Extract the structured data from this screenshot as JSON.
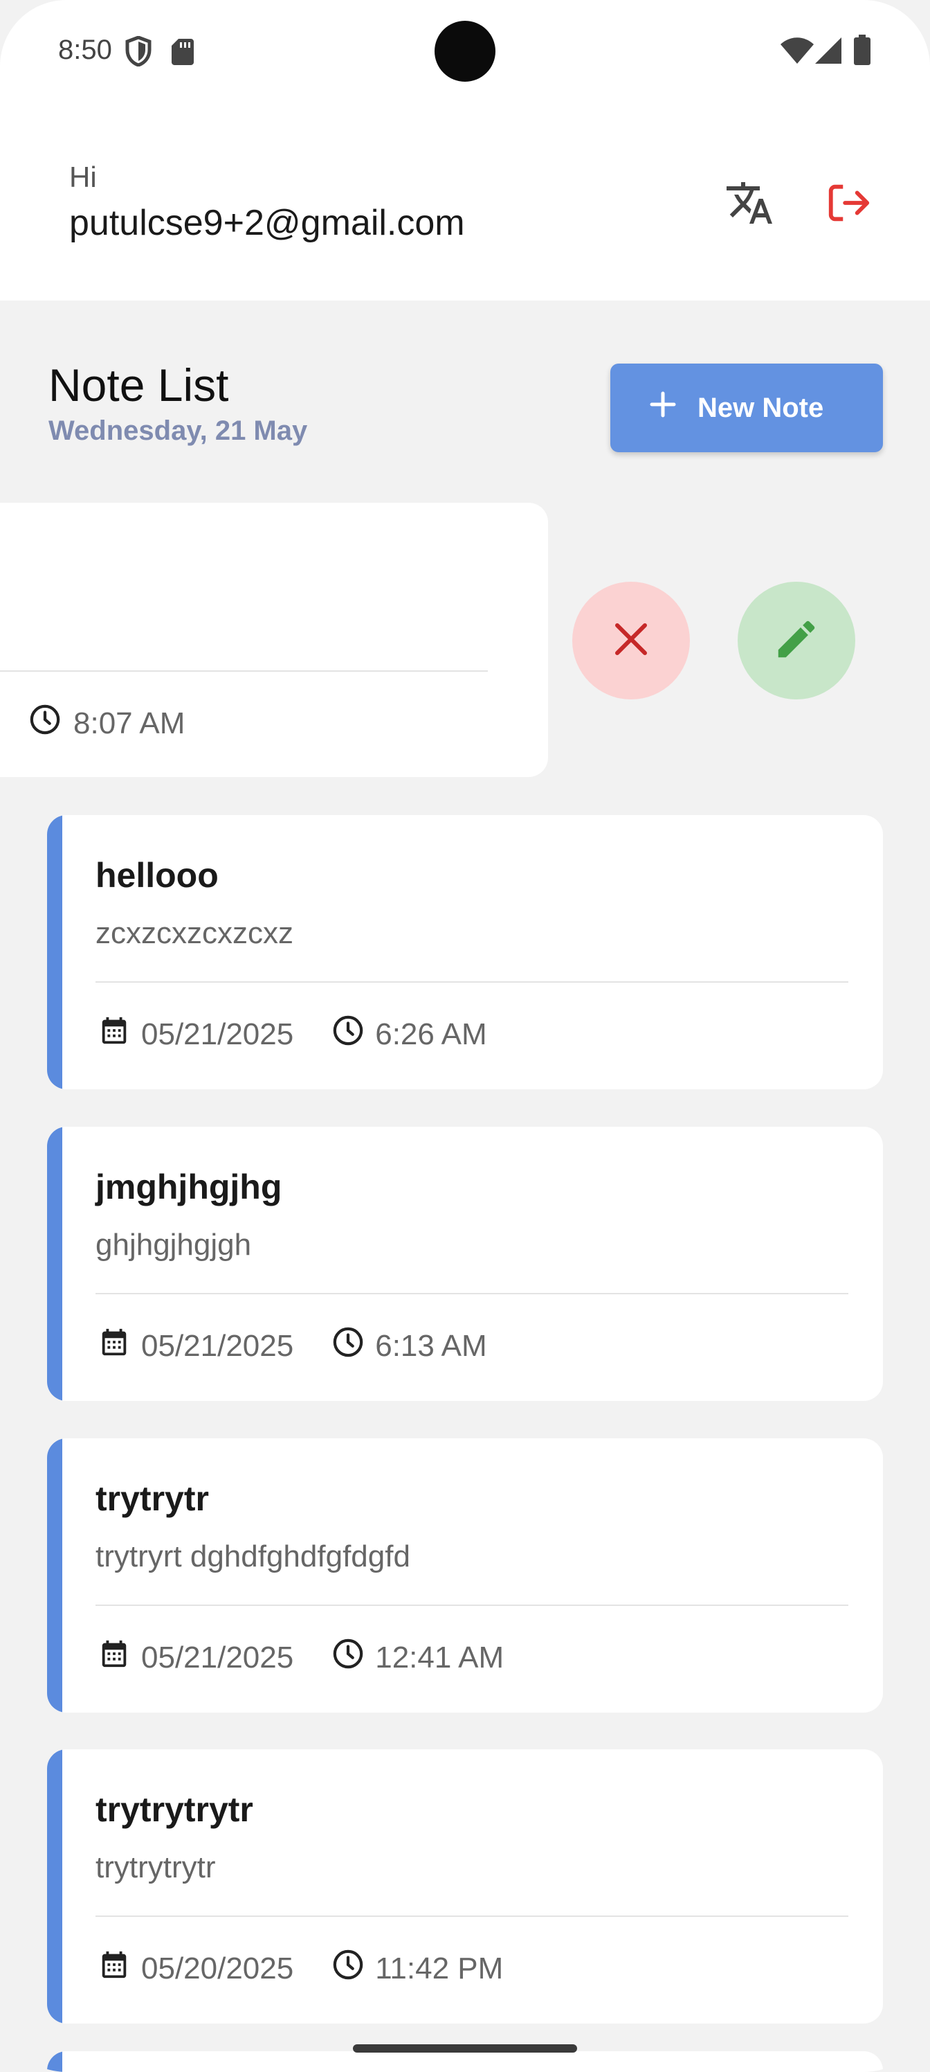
{
  "status_bar": {
    "time": "8:50",
    "icons": [
      "shield-icon",
      "sd-card-icon",
      "wifi-icon",
      "cellular-icon",
      "battery-icon"
    ]
  },
  "header": {
    "greeting": "Hi",
    "email": "putulcse9+2@gmail.com",
    "translate_icon": "translate-icon",
    "logout_icon": "logout-icon",
    "logout_color": "#e53935"
  },
  "list_header": {
    "title": "Note List",
    "date": "Wednesday, 21 May",
    "new_note_label": "New Note",
    "new_note_color": "#6392e1"
  },
  "swiped_note": {
    "time": "8:07 AM",
    "actions": [
      {
        "name": "delete",
        "icon": "close-icon",
        "color": "#c62828",
        "bg": "#fbd2d2"
      },
      {
        "name": "edit",
        "icon": "pencil-icon",
        "color": "#43a047",
        "bg": "#c8e6c9"
      }
    ]
  },
  "notes": [
    {
      "title": "hellooo",
      "body": "zcxzcxzcxzcxz",
      "date": "05/21/2025",
      "time": "6:26 AM"
    },
    {
      "title": "jmghjhgjhg",
      "body": "ghjhgjhgjgh",
      "date": "05/21/2025",
      "time": "6:13 AM"
    },
    {
      "title": "trytrytr",
      "body": "trytryrt dghdfghdfgfdgfd",
      "date": "05/21/2025",
      "time": "12:41 AM"
    },
    {
      "title": "trytrytrytr",
      "body": "trytrytrytr",
      "date": "05/20/2025",
      "time": "11:42 PM"
    }
  ],
  "accent_color": "#5b8bde"
}
